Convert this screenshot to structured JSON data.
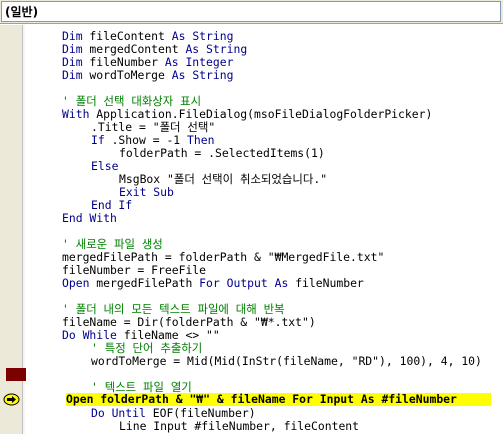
{
  "procedure_combo": {
    "value": "(일반)"
  },
  "colors": {
    "keyword": "#00008b",
    "comment": "#008000",
    "execution_highlight": "#ffff00",
    "breakpoint": "#7b0000"
  },
  "margin": {
    "execution_indicator_icon": "execution-pointer-arrow"
  },
  "code_lines": [
    "Dim fileContent As String",
    "Dim mergedContent As String",
    "Dim fileNumber As Integer",
    "Dim wordToMerge As String",
    "",
    "' 폴더 선택 대화상자 표시",
    "With Application.FileDialog(msoFileDialogFolderPicker)",
    ".Title = \"폴더 선택\"",
    "If .Show = -1 Then",
    "folderPath = .SelectedItems(1)",
    "Else",
    "MsgBox \"폴더 선택이 취소되었습니다.\"",
    "Exit Sub",
    "End If",
    "End With",
    "",
    "' 새로운 파일 생성",
    "mergedFilePath = folderPath & \"₩MergedFile.txt\"",
    "fileNumber = FreeFile",
    "Open mergedFilePath For Output As fileNumber",
    "",
    "' 폴더 내의 모든 텍스트 파일에 대해 반복",
    "fileName = Dir(folderPath & \"₩*.txt\")",
    "Do While fileName <> \"\"",
    "' 특정 단어 추출하기",
    "wordToMerge = Mid(Mid(InStr(fileName, \"RD\"), 100), 4, 10)",
    "",
    "' 텍스트 파일 열기",
    "Open folderPath & \"₩\" & fileName For Input As #fileNumber",
    "Do Until EOF(fileNumber)",
    "Line Input #fileNumber, fileContent"
  ]
}
